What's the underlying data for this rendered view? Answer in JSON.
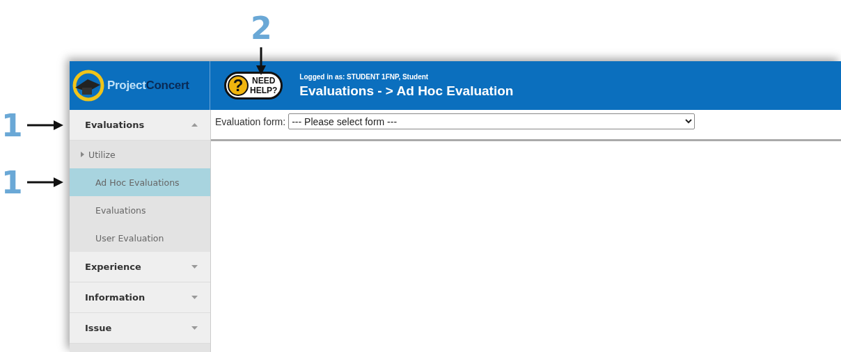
{
  "logo": {
    "first": "Project",
    "second": "Concert"
  },
  "help": {
    "symbol": "?",
    "line1": "NEED",
    "line2": "HELP?",
    "callout": "2"
  },
  "header": {
    "user": "Logged in as: STUDENT 1FNP, Student",
    "title": "Evaluations - > Ad Hoc Evaluation"
  },
  "sidebar": {
    "groups": [
      {
        "label": "Evaluations",
        "expanded": true,
        "callout": "1",
        "items": [
          {
            "label": "Utilize",
            "kind": "folder",
            "selected": false
          },
          {
            "label": "Ad Hoc Evaluations",
            "kind": "link",
            "selected": true,
            "callout": "1"
          },
          {
            "label": "Evaluations",
            "kind": "link",
            "selected": false
          },
          {
            "label": "User Evaluation",
            "kind": "link",
            "selected": false
          }
        ]
      },
      {
        "label": "Experience",
        "expanded": false
      },
      {
        "label": "Information",
        "expanded": false
      },
      {
        "label": "Issue",
        "expanded": false
      }
    ]
  },
  "form": {
    "label": "Evaluation form:",
    "value": "--- Please select form ---"
  }
}
